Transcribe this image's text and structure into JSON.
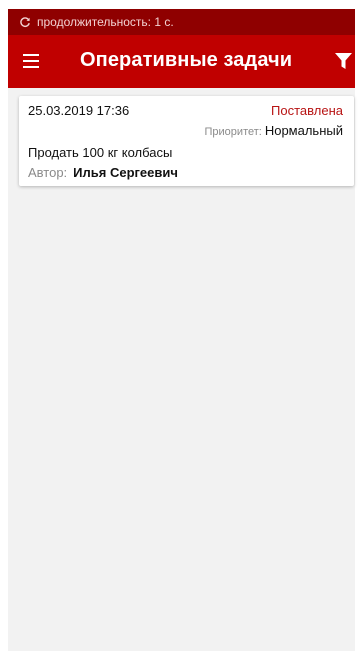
{
  "status_bar": {
    "icon": "refresh-icon",
    "text": "продолжительность: 1 с.",
    "color": "#8f0000"
  },
  "app_bar": {
    "menu_icon": "hamburger-menu-icon",
    "title": "Оперативные задачи",
    "filter_icon": "filter-icon",
    "color": "#c00000"
  },
  "tasks": [
    {
      "date": "25.03.2019 17:36",
      "status": "Поставлена",
      "status_color": "#b81414",
      "priority_label": "Приоритет:",
      "priority_value": "Нормальный",
      "title": "Продать 100 кг колбасы",
      "author_label": "Автор:",
      "author_name": "Илья Сергеевич"
    }
  ]
}
